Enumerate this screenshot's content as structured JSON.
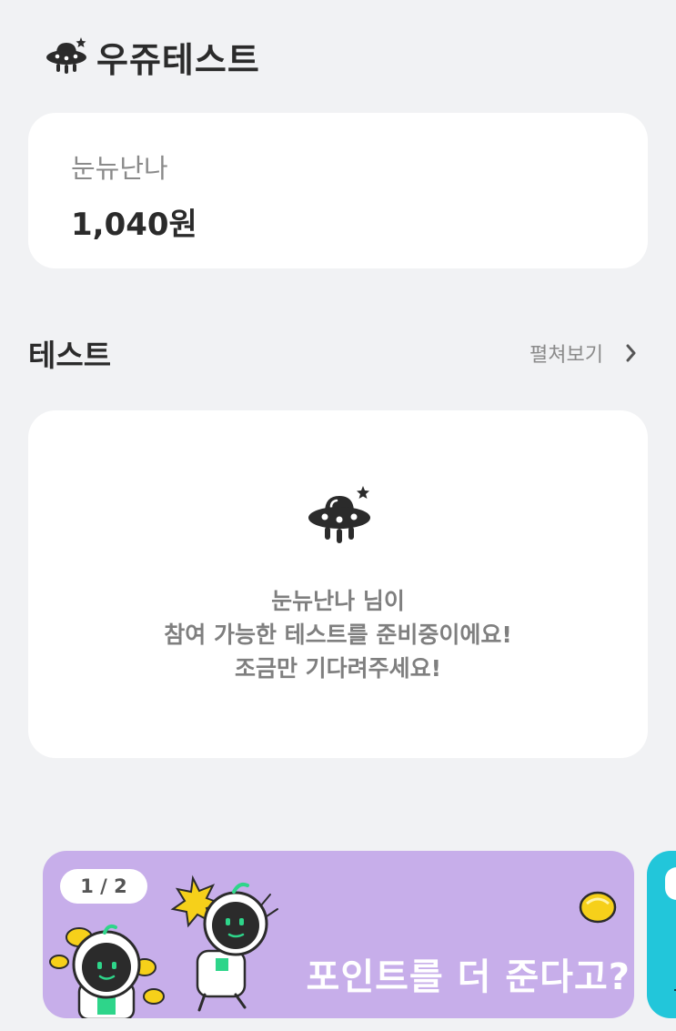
{
  "header": {
    "app_title": "우쥬테스트",
    "logo_icon": "ufo-icon"
  },
  "user_card": {
    "name": "눈뉴난나",
    "balance": "1,040원"
  },
  "test_section": {
    "title": "테스트",
    "more_label": "펼쳐보기",
    "empty_message": [
      "눈뉴난나 님이",
      "참여 가능한 테스트를 준비중이에요!",
      "조금만 기다려주세요!"
    ]
  },
  "banner": {
    "page_indicator": "1 / 2",
    "text": "포인트를 더 준다고?",
    "background": "#c7aeea",
    "next_banner_color": "#22c6da"
  },
  "colors": {
    "background": "#f1f2f4",
    "card": "#ffffff",
    "muted_text": "#8a8a8a",
    "dark_text": "#2b2b2b",
    "coin": "#f6d01a",
    "astronaut_accent": "#2ed58a"
  }
}
